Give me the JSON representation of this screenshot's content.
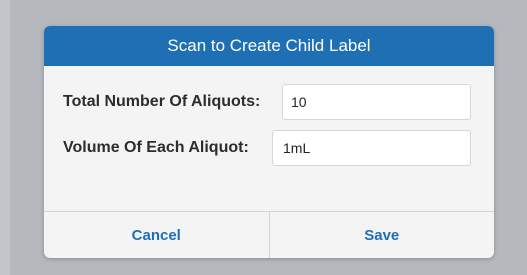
{
  "dialog": {
    "title": "Scan to Create Child Label",
    "fields": [
      {
        "label": "Total Number Of Aliquots:",
        "value": "10"
      },
      {
        "label": "Volume Of Each Aliquot:",
        "value": "1mL"
      }
    ],
    "cancel_label": "Cancel",
    "save_label": "Save"
  },
  "colors": {
    "header": "#1f6fb5",
    "button_text": "#1f6fb5",
    "dialog_bg": "#f4f4f5",
    "backdrop": "#b5b9be"
  }
}
